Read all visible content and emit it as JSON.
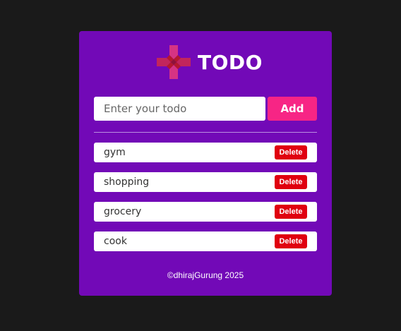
{
  "app": {
    "title": "TODO",
    "logo_icon": "plus-cross-logo-icon"
  },
  "input": {
    "placeholder": "Enter your todo",
    "value": ""
  },
  "add_button": {
    "label": "Add"
  },
  "todos": [
    {
      "text": "gym",
      "delete_label": "Delete"
    },
    {
      "text": "shopping",
      "delete_label": "Delete"
    },
    {
      "text": "grocery",
      "delete_label": "Delete"
    },
    {
      "text": "cook",
      "delete_label": "Delete"
    }
  ],
  "footer": {
    "text": "©dhirajGurung 2025"
  },
  "colors": {
    "page_background": "#1a1a1a",
    "card_background": "#7209b7",
    "accent": "#f72585",
    "delete": "#e0000f",
    "logo_primary": "#d63384",
    "logo_secondary": "#b5172f"
  }
}
